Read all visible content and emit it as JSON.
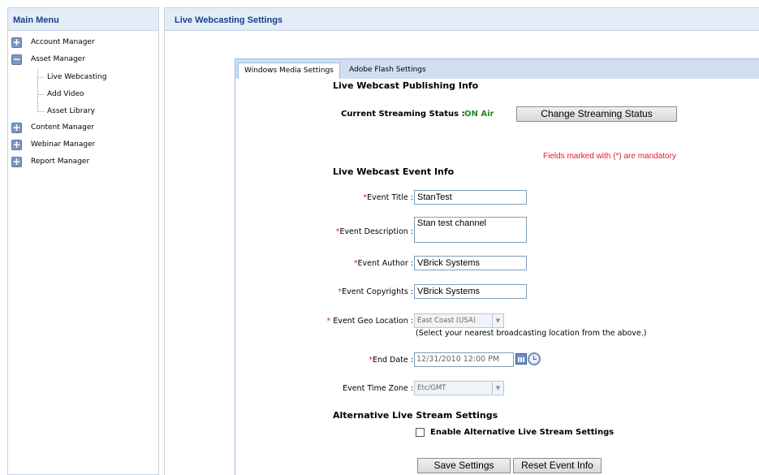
{
  "left_panel": {
    "title": "Main Menu",
    "menu": [
      {
        "label": "Account Manager",
        "toggle": "+"
      },
      {
        "label": "Asset Manager",
        "toggle": "−"
      },
      {
        "label": "Content Manager",
        "toggle": "+"
      },
      {
        "label": "Webinar Manager",
        "toggle": "+"
      },
      {
        "label": "Report Manager",
        "toggle": "+"
      }
    ],
    "asset_children": [
      "Live Webcasting",
      "Add Video",
      "Asset Library"
    ]
  },
  "right_panel": {
    "title": "Live Webcasting Settings"
  },
  "tabs": {
    "active": "Windows Media Settings",
    "inactive": "Adobe Flash Settings"
  },
  "publishing": {
    "title": "Live Webcast Publishing Info",
    "status_label": "Current Streaming Status :",
    "status_value": "ON Air",
    "status_color": "#1f8a1f",
    "change_button": "Change Streaming Status"
  },
  "mandatory_note": "Fields marked with (*) are mandatory",
  "event_info": {
    "title": "Live Webcast Event Info",
    "required_mark": "*",
    "event_title_label": "Event Title :",
    "event_title_value": "StanTest",
    "event_description_label": "Event Description :",
    "event_description_value": "Stan test channel",
    "event_author_label": "Event Author :",
    "event_author_value": "VBrick Systems",
    "event_copyrights_label": "Event Copyrights :",
    "event_copyrights_value": "VBrick Systems",
    "geo_location_label": " Event Geo Location :",
    "geo_location_value": "East Coast (USA)",
    "geo_hint": "(Select your nearest broadcasting location from the above.)",
    "end_date_label": "End Date :",
    "end_date_value": "12/31/2010 12:00 PM",
    "time_zone_label": "Event Time Zone :",
    "time_zone_value": "Etc/GMT"
  },
  "alternative": {
    "title": "Alternative Live Stream Settings",
    "checkbox_label": "Enable Alternative Live Stream Settings",
    "checked": false
  },
  "buttons": {
    "save": "Save Settings",
    "reset": "Reset Event Info"
  },
  "icons": {
    "calendar": "calendar-icon",
    "clock": "clock-icon",
    "dropdown": "▼"
  }
}
